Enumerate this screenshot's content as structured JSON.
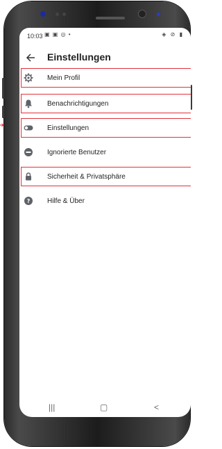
{
  "status_bar": {
    "time": "10:03",
    "icons_left": "▣ ▣ ◎ •",
    "icons_right": "◈ ⊘ ▮"
  },
  "app_bar": {
    "back_icon": "back-arrow-icon",
    "title": "Einstellungen"
  },
  "menu": {
    "items": [
      {
        "label": "Mein Profil",
        "icon": "gear-icon",
        "highlighted": true
      },
      {
        "label": "Benachrichtigungen",
        "icon": "bell-icon",
        "highlighted": true
      },
      {
        "label": "Einstellungen",
        "icon": "toggle-icon",
        "highlighted": true
      },
      {
        "label": "Ignorierte Benutzer",
        "icon": "block-icon",
        "highlighted": false
      },
      {
        "label": "Sicherheit & Privatsphäre",
        "icon": "lock-icon",
        "highlighted": true
      },
      {
        "label": "Hilfe & Über",
        "icon": "help-icon",
        "highlighted": false
      }
    ]
  },
  "nav_bar": {
    "recent": "|||",
    "home": "▢",
    "back": "<"
  },
  "colors": {
    "highlight": "#e0303a",
    "icon": "#5f6368",
    "text": "#222222"
  }
}
